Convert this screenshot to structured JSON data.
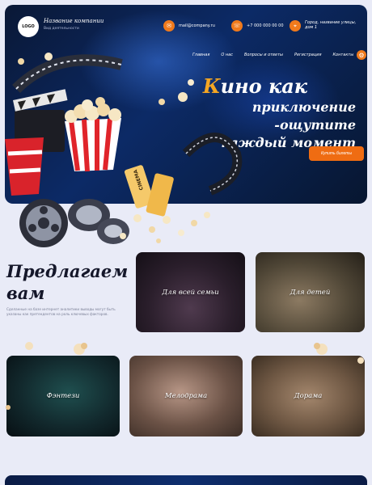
{
  "header": {
    "logo_text": "LOGO",
    "company_name": "Название компании",
    "company_sub": "Вид деятельности",
    "email": "mail@company.ru",
    "phone": "+7 000 000 00 00",
    "address": "Город, название улицы, дом 1",
    "email_icon": "mail-icon",
    "phone_icon": "phone-icon",
    "address_icon": "map-pin-icon"
  },
  "nav": {
    "items": [
      {
        "label": "Главная"
      },
      {
        "label": "О нас"
      },
      {
        "label": "Вопросы и ответы"
      },
      {
        "label": "Регистрация"
      },
      {
        "label": "Контакты"
      }
    ],
    "settings_icon": "gear-icon"
  },
  "hero": {
    "title_first_letter": "К",
    "title_rest_line1": "ино как",
    "title_line2": "приключение -ощутите",
    "title_line3": "каждый момент",
    "cta_label": "Купить билеты",
    "ticket_text": "CINEMA"
  },
  "offer": {
    "title": "Предлагаем вам",
    "text": "Сделанные на базе интернет аналитики выводы могут быть указаны как претендентов на роль ключевых факторов."
  },
  "cards": [
    {
      "label": "Для всей семьи"
    },
    {
      "label": "Для детей"
    },
    {
      "label": "Фэнтези"
    },
    {
      "label": "Мелодрама"
    },
    {
      "label": "Дорама"
    }
  ],
  "colors": {
    "accent": "#ef6c12",
    "hero_bg": "#0c2a66",
    "page_bg": "#e9ebf7",
    "title_gold": "#f5a623"
  }
}
